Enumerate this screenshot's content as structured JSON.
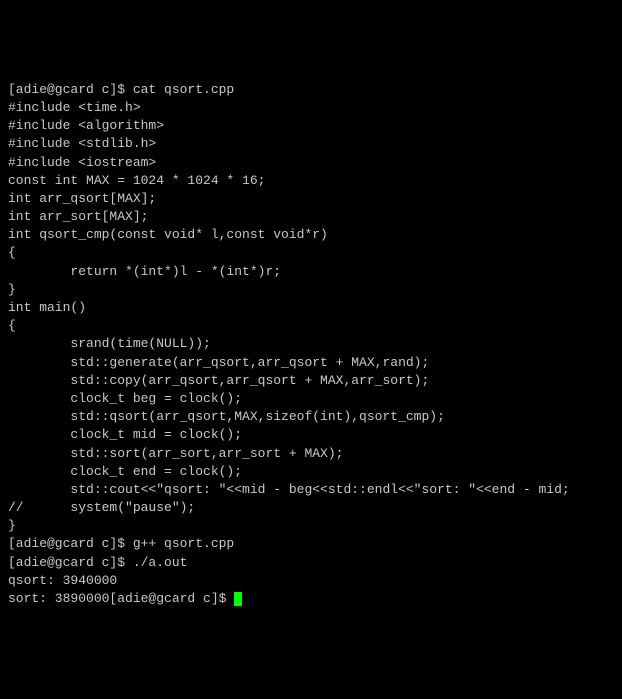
{
  "lines": [
    "[adie@gcard c]$ cat qsort.cpp",
    "#include <time.h>",
    "#include <algorithm>",
    "#include <stdlib.h>",
    "#include <iostream>",
    "const int MAX = 1024 * 1024 * 16;",
    "int arr_qsort[MAX];",
    "int arr_sort[MAX];",
    "",
    "int qsort_cmp(const void* l,const void*r)",
    "{",
    "        return *(int*)l - *(int*)r;",
    "}",
    "int main()",
    "{",
    "        srand(time(NULL));",
    "        std::generate(arr_qsort,arr_qsort + MAX,rand);",
    "        std::copy(arr_qsort,arr_qsort + MAX,arr_sort);",
    "        clock_t beg = clock();",
    "        std::qsort(arr_qsort,MAX,sizeof(int),qsort_cmp);",
    "        clock_t mid = clock();",
    "        std::sort(arr_sort,arr_sort + MAX);",
    "        clock_t end = clock();",
    "        std::cout<<\"qsort: \"<<mid - beg<<std::endl<<\"sort: \"<<end - mid;",
    "//      system(\"pause\");",
    "}",
    "[adie@gcard c]$ g++ qsort.cpp",
    "[adie@gcard c]$ ./a.out",
    "qsort: 3940000"
  ],
  "final_line": "sort: 3890000[adie@gcard c]$ "
}
